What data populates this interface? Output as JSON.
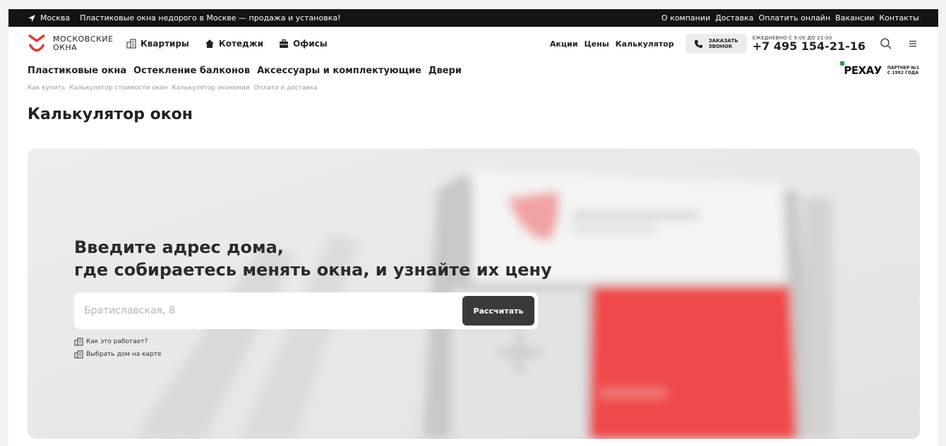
{
  "topbar": {
    "city": "Москва",
    "promo": "Пластиковые окна недорого в Москве — продажа и установка!",
    "links": [
      "О компании",
      "Доставка",
      "Оплатить онлайн",
      "Вакансии",
      "Контакты"
    ]
  },
  "header": {
    "logo_line1": "Московские",
    "logo_line2": "Окна",
    "categories": [
      "Квартиры",
      "Котеджи",
      "Офисы"
    ],
    "nav": [
      "Акции",
      "Цены",
      "Калькулятор"
    ],
    "call_line1": "Заказать",
    "call_line2": "звонок",
    "hours": "ЕЖЕДНЕВНО С 9:00 ДО 21:00",
    "phone": "+7 495 154-21-16"
  },
  "subnav": {
    "items": [
      "Пластиковые окна",
      "Остекление балконов",
      "Аксессуары и комплектующие",
      "Двери"
    ],
    "partner_brand": "РЕХАУ",
    "partner_line1": "Партнер №1",
    "partner_line2": "с 1992 года"
  },
  "breadcrumbs": [
    "Как купить",
    "Калькулятор стоимости окон",
    "Калькулятор экономии",
    "Оплата и доставка"
  ],
  "page_title": "Калькулятор окон",
  "hero": {
    "heading_line1": "Введите адрес дома,",
    "heading_line2": "где собираетесь менять окна, и узнайте их цену",
    "placeholder": "Братиславская, 8",
    "button": "Рассчитать",
    "link1": "Как это работает?",
    "link2": "Выбрать дом на карте"
  },
  "colors": {
    "accent": "#e63636",
    "dark": "#141414",
    "button": "#3a3a3a"
  }
}
